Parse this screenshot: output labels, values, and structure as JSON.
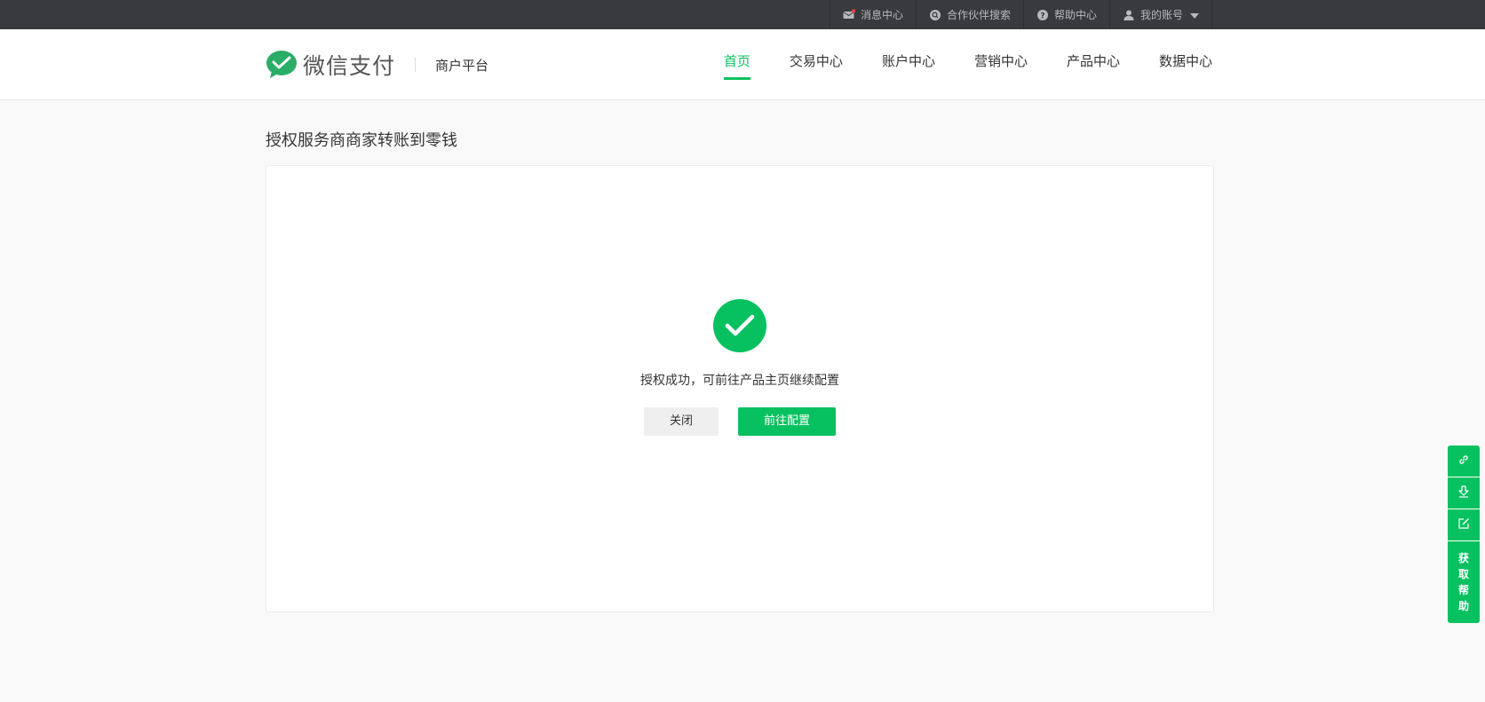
{
  "topbar": {
    "items": [
      {
        "label": "消息中心",
        "icon": "mail-icon"
      },
      {
        "label": "合作伙伴搜索",
        "icon": "partner-search-icon"
      },
      {
        "label": "帮助中心",
        "icon": "help-icon"
      },
      {
        "label": "我的账号",
        "icon": "user-icon"
      }
    ]
  },
  "header": {
    "brand_name": "微信支付",
    "brand_sub": "商户平台",
    "nav": [
      {
        "label": "首页",
        "active": true
      },
      {
        "label": "交易中心"
      },
      {
        "label": "账户中心"
      },
      {
        "label": "营销中心"
      },
      {
        "label": "产品中心"
      },
      {
        "label": "数据中心"
      }
    ]
  },
  "main": {
    "title": "授权服务商商家转账到零钱",
    "success_message": "授权成功，可前往产品主页继续配置",
    "close_label": "关闭",
    "configure_label": "前往配置"
  },
  "float_bar": {
    "icons": [
      "link-icon",
      "download-icon",
      "edit-icon"
    ],
    "help_chars": [
      "获",
      "取",
      "帮",
      "助"
    ]
  },
  "colors": {
    "accent": "#07c160",
    "topbar_bg": "#393a3e",
    "page_bg": "#f9f9f9"
  }
}
